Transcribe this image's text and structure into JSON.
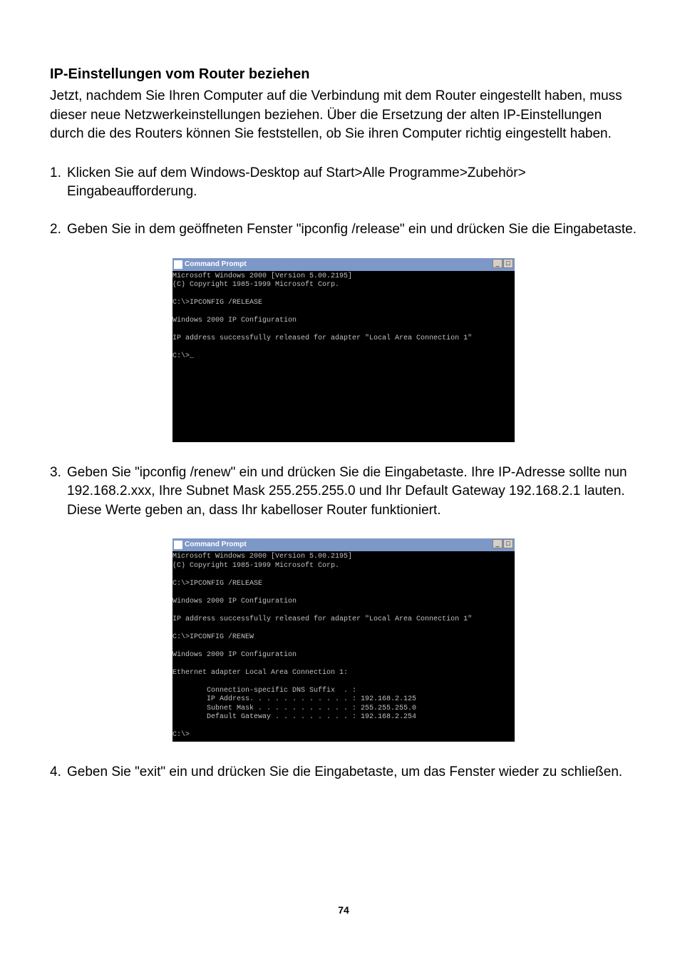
{
  "heading": "IP-Einstellungen vom Router beziehen",
  "intro": "Jetzt, nachdem Sie Ihren Computer auf die Verbindung mit dem Router eingestellt haben, muss dieser neue Netzwerkeinstellungen beziehen. Über die Ersetzung der alten IP-Einstellungen durch die des Routers können Sie feststellen, ob Sie ihren Computer richtig eingestellt haben.",
  "steps": {
    "s1": {
      "num": "1.",
      "text": "Klicken Sie auf dem Windows-Desktop auf Start>Alle Programme>Zubehör> Eingabeaufforderung."
    },
    "s2": {
      "num": "2.",
      "text": "Geben Sie in dem geöffneten Fenster \"ipconfig /release\" ein und drücken Sie die Eingabetaste."
    },
    "s3": {
      "num": "3.",
      "text": "Geben Sie \"ipconfig /renew\" ein und drücken Sie die Eingabetaste. Ihre IP-Adresse sollte nun 192.168.2.xxx, Ihre Subnet Mask 255.255.255.0 und Ihr Default Gateway 192.168.2.1 lauten. Diese Werte geben an, dass Ihr kabelloser Router funktioniert."
    },
    "s4": {
      "num": "4.",
      "text": "Geben Sie \"exit\" ein und drücken Sie die Eingabetaste, um das Fenster wieder zu schließen."
    }
  },
  "terminal1": {
    "title": "Command Prompt",
    "body": "Microsoft Windows 2000 [Version 5.00.2195]\n(C) Copyright 1985-1999 Microsoft Corp.\n\nC:\\>IPCONFIG /RELEASE\n\nWindows 2000 IP Configuration\n\nIP address successfully released for adapter \"Local Area Connection 1\"\n\nC:\\>_"
  },
  "terminal2": {
    "title": "Command Prompt",
    "body": "Microsoft Windows 2000 [Version 5.00.2195]\n(C) Copyright 1985-1999 Microsoft Corp.\n\nC:\\>IPCONFIG /RELEASE\n\nWindows 2000 IP Configuration\n\nIP address successfully released for adapter \"Local Area Connection 1\"\n\nC:\\>IPCONFIG /RENEW\n\nWindows 2000 IP Configuration\n\nEthernet adapter Local Area Connection 1:\n\n        Connection-specific DNS Suffix  . :\n        IP Address. . . . . . . . . . . . : 192.168.2.125\n        Subnet Mask . . . . . . . . . . . : 255.255.255.0\n        Default Gateway . . . . . . . . . : 192.168.2.254\n\nC:\\>"
  },
  "page_number": "74",
  "window_controls": {
    "min": "_",
    "max": "□"
  }
}
